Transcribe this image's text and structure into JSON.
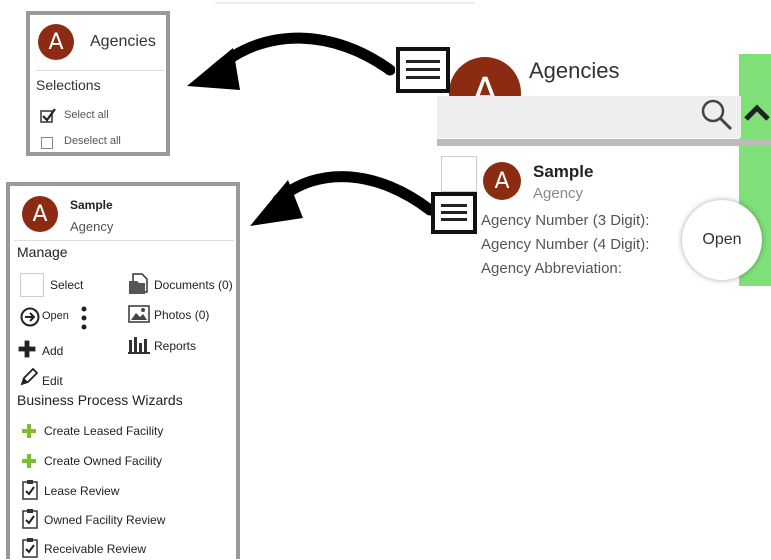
{
  "panel1": {
    "avatar_letter": "A",
    "title": "Agencies",
    "section": "Selections",
    "select_all": "Select all",
    "deselect_all": "Deselect all"
  },
  "panel2": {
    "avatar_letter": "A",
    "name_line1": "Sample",
    "name_line2": "Agency",
    "manage_title": "Manage",
    "manage": {
      "select": "Select",
      "documents": "Documents (0)",
      "open": "Open",
      "photos": "Photos (0)",
      "add": "Add",
      "reports": "Reports",
      "edit": "Edit"
    },
    "wizards_title": "Business Process Wizards",
    "wizards": [
      "Create Leased Facility",
      "Create Owned Facility",
      "Lease Review",
      "Owned Facility Review",
      "Receivable Review"
    ]
  },
  "right": {
    "avatar_letter": "A",
    "title": "Agencies",
    "item": {
      "avatar_letter": "A",
      "name": "Sample",
      "subtitle": "Agency",
      "fields": [
        "Agency Number (3 Digit):",
        "Agency Number (4 Digit):",
        "Agency Abbreviation:"
      ],
      "open_label": "Open"
    }
  },
  "colors": {
    "avatar": "#8b2c12",
    "green_bar": "#7fe07a",
    "plus_green": "#7bbf2c",
    "panel_border": "#9a9a9a"
  },
  "icons": [
    "menu-icon",
    "arrow-icon",
    "search-icon",
    "chevron-up-icon",
    "checkbox-checked-icon",
    "documents-icon",
    "photos-icon",
    "reports-icon",
    "pencil-icon",
    "kebab-icon",
    "clipboard-icon"
  ]
}
